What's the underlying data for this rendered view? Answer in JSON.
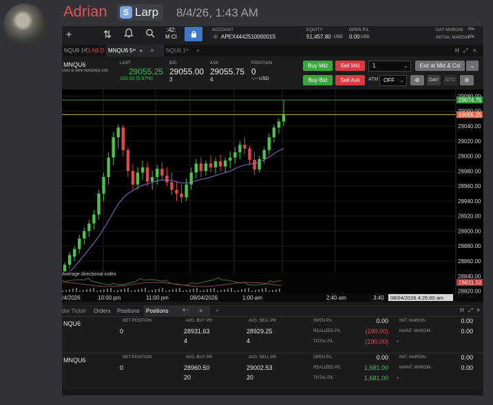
{
  "message": {
    "username": "Adrian",
    "tag": "Larp",
    "timestamp": "8/4/26, 1:43 AM"
  },
  "toolbar": {
    "time_partial": ":42:",
    "time_partial2": "M CI",
    "account_label": "ACCOUNT",
    "account_value": "APEX4442510000015",
    "equity_label": "EQUITY",
    "equity_value": "51,457.80",
    "equity_unit": "USD",
    "open_pl_label": "OPEN P/L",
    "open_pl_value": "0.00",
    "open_pl_unit": "USD",
    "day_margin_label": "DAY MARGIN",
    "day_margin_value": "0%",
    "initial_margin_label": "INITIAL MARGIN",
    "initial_margin_value": "0%"
  },
  "tabs": [
    "NQU6 1ᵐ",
    "CLN6 D",
    "MNQU6 5ᵐ",
    "NQU6 1ᵐ"
  ],
  "quote": {
    "symbol": "MNQU6",
    "description": "CRO E-MINI NASDAQ-100",
    "last_label": "LAST",
    "last_value": "29055.25",
    "last_change": "163.50 (0.57%)",
    "bid_label": "BID",
    "bid_value": "29055.00",
    "bid_size": "3",
    "ask_label": "ASK",
    "ask_value": "29055.75",
    "ask_size": "4",
    "position_label": "POSITION",
    "position_value": "0",
    "position_unit": "-.-- USD",
    "buy_mkt": "Buy Mkt",
    "sell_mkt": "Sell Mkt",
    "buy_bid": "Buy Bid",
    "sell_ask": "Sell Ask",
    "qty": "1",
    "exit": "Exit at Mkt & Cxl",
    "atm_label": "ATM",
    "atm_value": "OFF",
    "day": "DAY",
    "gtc": "GTC"
  },
  "chart_data": {
    "type": "candlestick",
    "symbol": "MNQU6 5m",
    "y_ticks": [
      "29080.00",
      "29060.00",
      "29040.00",
      "29020.00",
      "29000.00",
      "28980.00",
      "28960.00",
      "28940.00",
      "28920.00",
      "28900.00",
      "28880.00",
      "28860.00",
      "28840.00",
      "28820.00"
    ],
    "ylim": [
      28815,
      29085
    ],
    "price_tags": [
      "29074.75",
      "29055.25",
      "28831.50"
    ],
    "price_tag_values": [
      29074.75,
      29055.25,
      28831.5
    ],
    "x_ticks": [
      "/4/2026",
      "10:00 pm",
      "11:00 pm",
      "08/04/2026",
      "1:00 am",
      "2:40 am",
      "3:40"
    ],
    "crosshair_time": "08/04/2026 4:25:00 am",
    "indicator_label": "Average directional index",
    "candles": [
      {
        "o": 28845,
        "h": 28858,
        "l": 28838,
        "c": 28855
      },
      {
        "o": 28855,
        "h": 28872,
        "l": 28850,
        "c": 28868
      },
      {
        "o": 28866,
        "h": 28880,
        "l": 28860,
        "c": 28876
      },
      {
        "o": 28876,
        "h": 28895,
        "l": 28870,
        "c": 28890
      },
      {
        "o": 28890,
        "h": 28905,
        "l": 28882,
        "c": 28900
      },
      {
        "o": 28900,
        "h": 28915,
        "l": 28892,
        "c": 28910
      },
      {
        "o": 28910,
        "h": 28928,
        "l": 28902,
        "c": 28922
      },
      {
        "o": 28922,
        "h": 28955,
        "l": 28915,
        "c": 28950
      },
      {
        "o": 28950,
        "h": 28978,
        "l": 28940,
        "c": 28972
      },
      {
        "o": 28972,
        "h": 29005,
        "l": 28962,
        "c": 28998
      },
      {
        "o": 28998,
        "h": 29032,
        "l": 28988,
        "c": 29025
      },
      {
        "o": 29025,
        "h": 29042,
        "l": 29010,
        "c": 29038
      },
      {
        "o": 29038,
        "h": 29042,
        "l": 29000,
        "c": 29008
      },
      {
        "o": 29008,
        "h": 29012,
        "l": 28972,
        "c": 28980
      },
      {
        "o": 28980,
        "h": 28990,
        "l": 28955,
        "c": 28962
      },
      {
        "o": 28962,
        "h": 28985,
        "l": 28955,
        "c": 28978
      },
      {
        "o": 28978,
        "h": 28994,
        "l": 28968,
        "c": 28985
      },
      {
        "o": 28985,
        "h": 28992,
        "l": 28960,
        "c": 28966
      },
      {
        "o": 28966,
        "h": 28980,
        "l": 28955,
        "c": 28972
      },
      {
        "o": 28972,
        "h": 28988,
        "l": 28962,
        "c": 28983
      },
      {
        "o": 28983,
        "h": 28992,
        "l": 28968,
        "c": 28974
      },
      {
        "o": 28974,
        "h": 28985,
        "l": 28960,
        "c": 28965
      },
      {
        "o": 28965,
        "h": 28978,
        "l": 28948,
        "c": 28955
      },
      {
        "o": 28955,
        "h": 28965,
        "l": 28940,
        "c": 28950
      },
      {
        "o": 28950,
        "h": 28962,
        "l": 28938,
        "c": 28945
      },
      {
        "o": 28945,
        "h": 28970,
        "l": 28940,
        "c": 28962
      },
      {
        "o": 28962,
        "h": 28985,
        "l": 28955,
        "c": 28978
      },
      {
        "o": 28978,
        "h": 28996,
        "l": 28970,
        "c": 28990
      },
      {
        "o": 28990,
        "h": 28998,
        "l": 28972,
        "c": 28980
      },
      {
        "o": 28980,
        "h": 28994,
        "l": 28974,
        "c": 28990
      },
      {
        "o": 28990,
        "h": 29000,
        "l": 28978,
        "c": 28985
      },
      {
        "o": 28985,
        "h": 28998,
        "l": 28976,
        "c": 28993
      },
      {
        "o": 28993,
        "h": 29002,
        "l": 28980,
        "c": 28986
      },
      {
        "o": 28986,
        "h": 28998,
        "l": 28978,
        "c": 28994
      },
      {
        "o": 28994,
        "h": 29006,
        "l": 28984,
        "c": 28998
      },
      {
        "o": 28998,
        "h": 29012,
        "l": 28990,
        "c": 29005
      },
      {
        "o": 29005,
        "h": 29020,
        "l": 28996,
        "c": 29015
      },
      {
        "o": 29015,
        "h": 29025,
        "l": 29002,
        "c": 29010
      },
      {
        "o": 29010,
        "h": 29014,
        "l": 28988,
        "c": 28995
      },
      {
        "o": 28995,
        "h": 29005,
        "l": 28975,
        "c": 28982
      },
      {
        "o": 28982,
        "h": 29000,
        "l": 28978,
        "c": 28996
      },
      {
        "o": 28996,
        "h": 29012,
        "l": 28990,
        "c": 29008
      },
      {
        "o": 29008,
        "h": 29030,
        "l": 29002,
        "c": 29025
      },
      {
        "o": 29025,
        "h": 29042,
        "l": 29018,
        "c": 29038
      },
      {
        "o": 29038,
        "h": 29050,
        "l": 29030,
        "c": 29046
      },
      {
        "o": 29046,
        "h": 29075,
        "l": 29040,
        "c": 29055
      }
    ],
    "ma": [
      28840,
      28846,
      28852,
      28860,
      28868,
      28876,
      28884,
      28893,
      28903,
      28914,
      28925,
      28936,
      28944,
      28950,
      28954,
      28958,
      28961,
      28963,
      28965,
      28967,
      28968,
      28968,
      28967,
      28966,
      28964,
      28964,
      28965,
      28967,
      28969,
      28970,
      28972,
      28974,
      28976,
      28978,
      28980,
      28983,
      28986,
      28988,
      28989,
      28990,
      28992,
      28995,
      28999,
      29003,
      29007,
      29010
    ]
  },
  "positions_tabs": [
    "der Ticket",
    "Orders",
    "Positions",
    "Positions"
  ],
  "positions": [
    {
      "symbol": "NQU6",
      "net_position_label": "NET POSITION",
      "net_position": "0",
      "avg_buy_label": "AVG. BUY PR.",
      "avg_buy": "28931.63",
      "buy_qty": "4",
      "avg_sell_label": "AVG. SELL PR.",
      "avg_sell": "28929.25",
      "sell_qty": "4",
      "open_pl_label": "OPEN P/L",
      "open_pl": "0.00",
      "realized_label": "REALIZED P/L",
      "realized": "(190.00)",
      "total_label": "TOTAL P/L",
      "total": "(190.00)",
      "init_margin_label": "INIT. MARGIN",
      "init_margin": "0.00",
      "maint_margin_label": "MAINT. MARGIN",
      "maint_margin": "0.00",
      "dash": "-"
    },
    {
      "symbol": "MNQU6",
      "net_position_label": "NET POSITION",
      "net_position": "0",
      "avg_buy_label": "AVG. BUY PR.",
      "avg_buy": "28960.50",
      "buy_qty": "20",
      "avg_sell_label": "AVG. SELL PR.",
      "avg_sell": "29002.53",
      "sell_qty": "20",
      "open_pl_label": "OPEN P/L",
      "open_pl": "0.00",
      "realized_label": "REALIZED P/L",
      "realized": "1,681.00",
      "total_label": "TOTAL P/L",
      "total": "1,681.00",
      "init_margin_label": "INIT. MARGIN",
      "init_margin": "0.00",
      "maint_margin_label": "MAINT. MARGIN",
      "maint_margin": "0.00",
      "dash": "-"
    }
  ]
}
